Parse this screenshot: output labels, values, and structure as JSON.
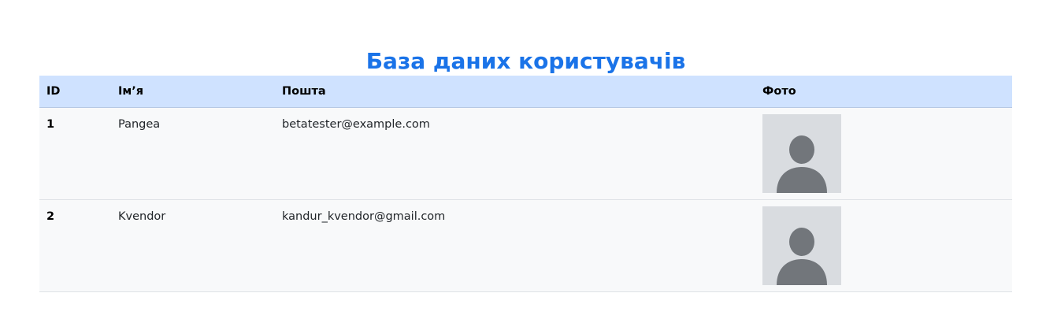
{
  "page": {
    "title": "База даних користувачів"
  },
  "table": {
    "headers": {
      "id": "ID",
      "name": "Ім’я",
      "email": "Пошта",
      "photo": "Фото"
    },
    "rows": [
      {
        "id": "1",
        "name": "Pangea",
        "email": "betatester@example.com",
        "photo_icon": "user-avatar-placeholder-icon"
      },
      {
        "id": "2",
        "name": "Kvendor",
        "email": "kandur_kvendor@gmail.com",
        "photo_icon": "user-avatar-placeholder-icon"
      }
    ]
  },
  "colors": {
    "title": "#1a73e8",
    "header_bg": "#cfe2ff",
    "row_bg": "#f8f9fa",
    "avatar_bg": "#d9dce0",
    "avatar_figure": "#72767b"
  }
}
